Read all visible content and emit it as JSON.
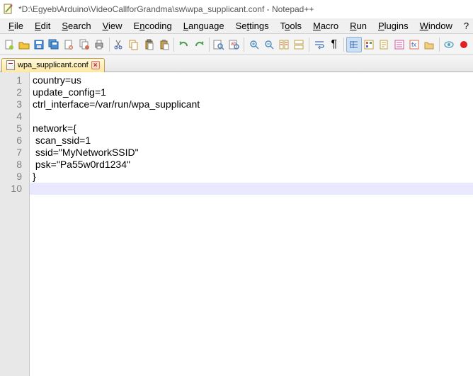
{
  "title": "*D:\\Egyeb\\Arduino\\VideoCallforGrandma\\sw\\wpa_supplicant.conf - Notepad++",
  "menus": {
    "file": "File",
    "edit": "Edit",
    "search": "Search",
    "view": "View",
    "encoding": "Encoding",
    "language": "Language",
    "settings": "Settings",
    "tools": "Tools",
    "macro": "Macro",
    "run": "Run",
    "plugins": "Plugins",
    "window": "Window",
    "help": "?"
  },
  "tab": {
    "name": "wpa_supplicant.conf"
  },
  "lines": [
    "country=us",
    "update_config=1",
    "ctrl_interface=/var/run/wpa_supplicant",
    "",
    "network={",
    " scan_ssid=1",
    " ssid=\"MyNetworkSSID\"",
    " psk=\"Pa55w0rd1234\"",
    "}",
    ""
  ],
  "line_numbers": [
    "1",
    "2",
    "3",
    "4",
    "5",
    "6",
    "7",
    "8",
    "9",
    "10"
  ],
  "icons": {
    "new": "#a9d08e",
    "open": "#f4c542",
    "save": "#4a90d9",
    "saveall": "#4a90d9",
    "closefile": "#d08050",
    "closeall": "#d08050",
    "print": "#888",
    "cut": "#888",
    "copy": "#c9a050",
    "paste": "#c9a050",
    "cp2": "#c9a050",
    "undo": "#4aa050",
    "redo": "#4aa050",
    "find": "#4a80c0",
    "replace": "#4a80c0",
    "zoomin": "#5090c0",
    "zoomout": "#5090c0",
    "zoomreset": "#5090c0",
    "syncv": "#c0a040",
    "synch": "#c0a040",
    "wordwrap": "#4070b0",
    "allchars": "#888",
    "indent": "#4070b0",
    "indent2": "#c0a040",
    "udlang": "#c0a040",
    "docmap": "#d050a0",
    "funclist": "#d07050",
    "folder": "#d07050",
    "monitor": "#50a0c0",
    "rec": "#d02020"
  }
}
